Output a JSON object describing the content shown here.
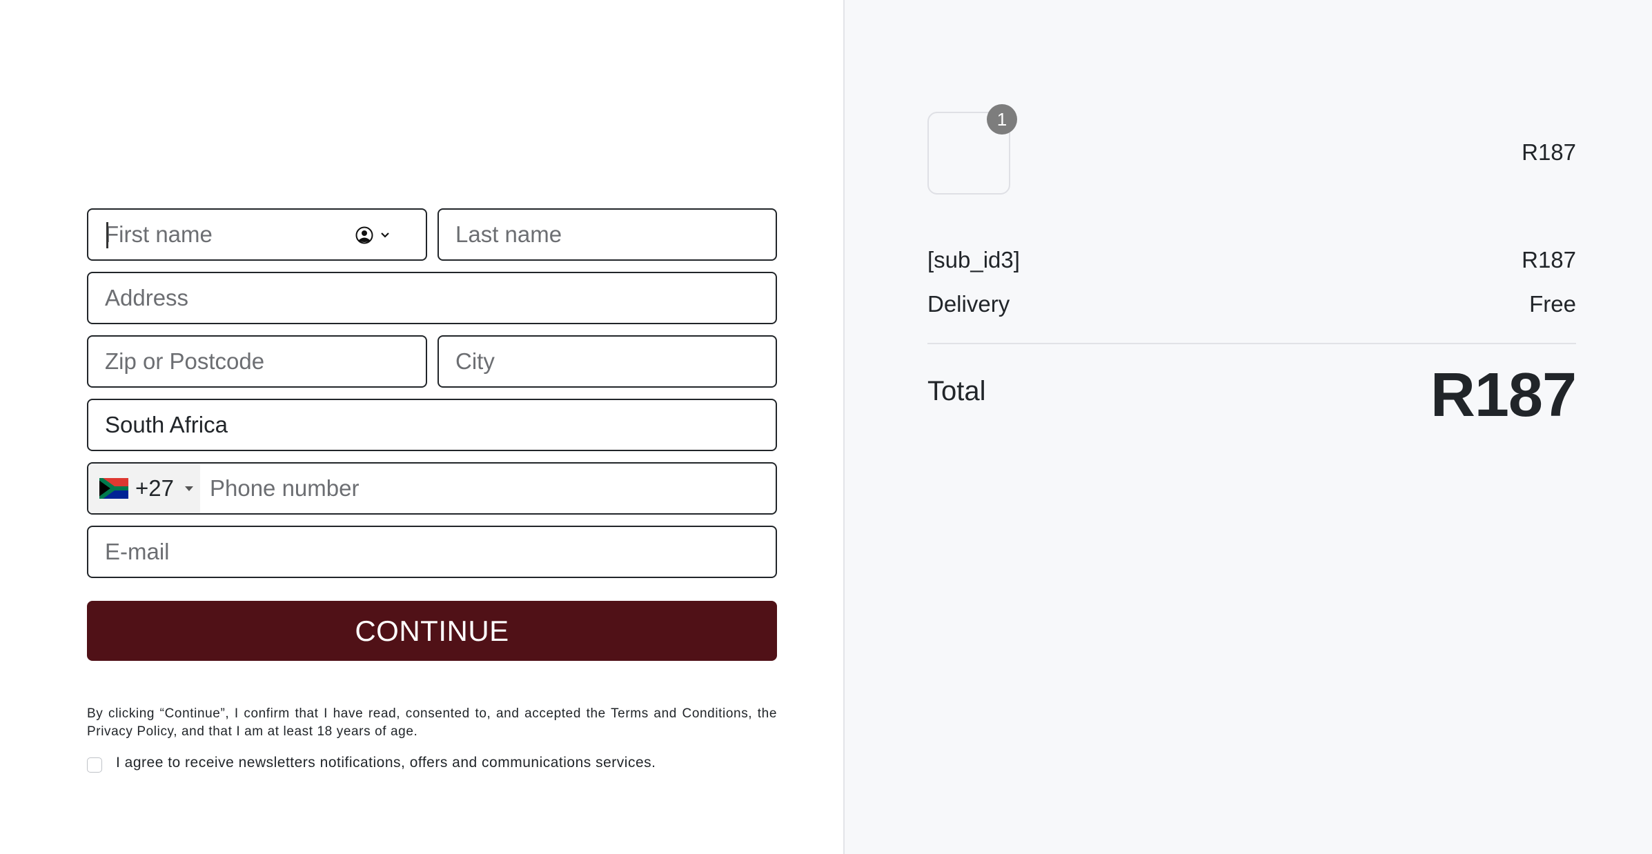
{
  "form": {
    "first_name": {
      "value": "",
      "placeholder": "First name"
    },
    "last_name": {
      "value": "",
      "placeholder": "Last name"
    },
    "address": {
      "value": "",
      "placeholder": "Address"
    },
    "zip": {
      "value": "",
      "placeholder": "Zip or Postcode"
    },
    "city": {
      "value": "",
      "placeholder": "City"
    },
    "country": {
      "value": "South Africa"
    },
    "phone": {
      "country_flag": "south-africa-flag",
      "dial_code": "+27",
      "value": "",
      "placeholder": "Phone number"
    },
    "email": {
      "value": "",
      "placeholder": "E-mail"
    },
    "continue_label": "CONTINUE",
    "legal_text": "By clicking “Continue”, I confirm that I have read, consented to, and accepted the Terms and Conditions, the Privacy Policy, and that I am at least 18 years of age.",
    "newsletter_label": "I agree to receive newsletters notifications, offers and communications services.",
    "newsletter_checked": false
  },
  "summary": {
    "item_quantity": "1",
    "item_price": "R187",
    "lines": [
      {
        "label": "[sub_id3]",
        "value": "R187"
      },
      {
        "label": "Delivery",
        "value": "Free"
      }
    ],
    "total_label": "Total",
    "total_value": "R187"
  },
  "colors": {
    "accent": "#501117",
    "summary_bg": "#f7f8fa",
    "badge": "#7d7d7d"
  }
}
